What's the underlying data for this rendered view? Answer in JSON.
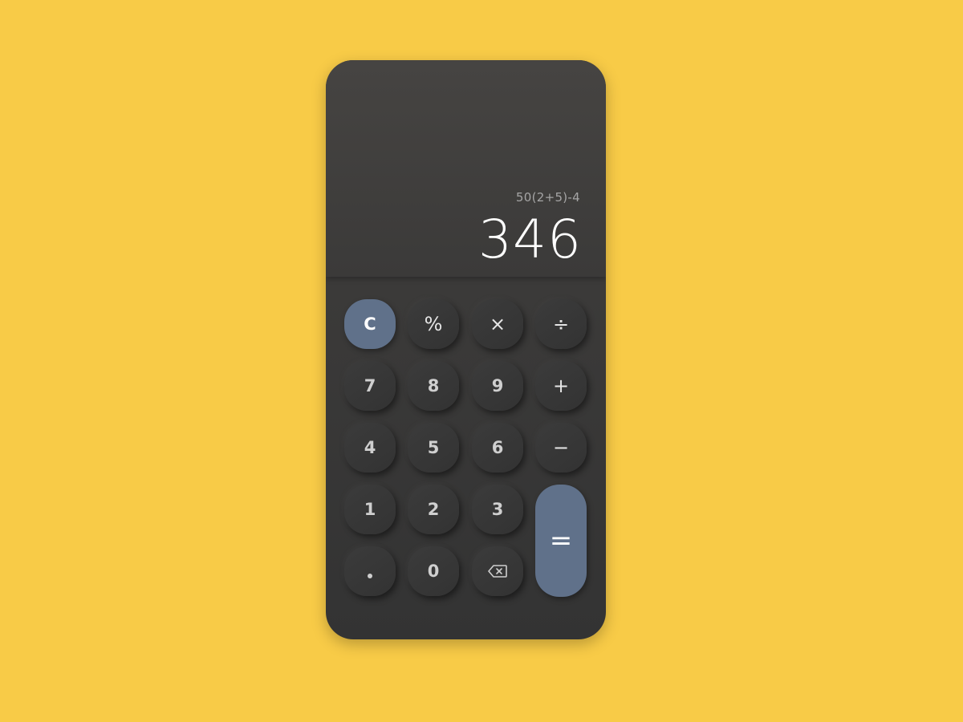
{
  "display": {
    "expression": "50(2+5)-4",
    "result": "346"
  },
  "keys": {
    "clear": "C",
    "percent": "%",
    "multiply": "×",
    "divide": "÷",
    "seven": "7",
    "eight": "8",
    "nine": "9",
    "plus": "+",
    "four": "4",
    "five": "5",
    "six": "6",
    "minus": "−",
    "one": "1",
    "two": "2",
    "three": "3",
    "equals": "=",
    "zero": "0"
  },
  "icons": {
    "decimal": "decimal-point-icon",
    "backspace": "backspace-icon"
  },
  "colors": {
    "background": "#F8CB47",
    "body": "#3b3a39",
    "accent": "#60718a",
    "result_text": "#ffffff",
    "expression_text": "#a5a5a5"
  }
}
